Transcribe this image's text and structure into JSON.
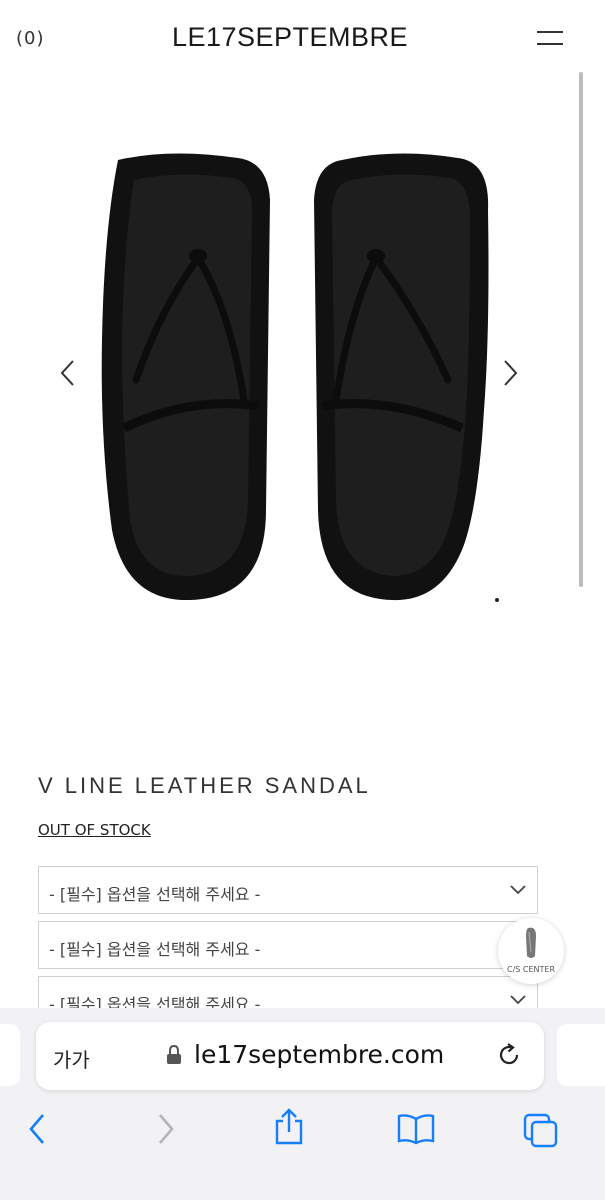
{
  "header": {
    "cart_count": "(0)",
    "brand": "LE17SEPTEMBRE"
  },
  "product": {
    "title": "V LINE LEATHER SANDAL",
    "stock_status": "OUT OF STOCK",
    "options": [
      "- [필수] 옵션을 선택해 주세요 -",
      "- [필수] 옵션을 선택해 주세요 -",
      "- [필수] 옵션을 선택해 주세요 -"
    ]
  },
  "cs_center": {
    "label": "C/S CENTER"
  },
  "browser": {
    "text_size_label": "가가",
    "url": "le17septembre.com"
  },
  "colors": {
    "accent": "#147efb",
    "sandal": "#111111",
    "sandal_inner": "#1e1e1e"
  }
}
